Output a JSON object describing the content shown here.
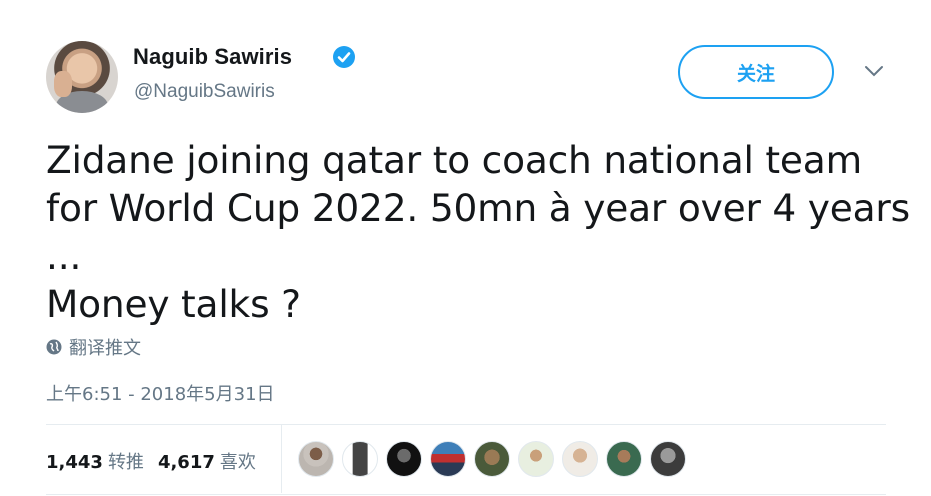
{
  "header": {
    "display_name": "Naguib Sawiris",
    "handle": "@NaguibSawiris",
    "verified": true,
    "follow_label": "关注",
    "accent_color": "#1da1f2"
  },
  "tweet": {
    "text": "Zidane joining qatar to coach national team\nfor World Cup 2022. 50mn à year over 4 years\n...\nMoney talks ?",
    "translate_label": "翻译推文",
    "timestamp": "上午6:51 - 2018年5月31日"
  },
  "stats": {
    "retweets_count": "1,443",
    "retweets_label": "转推",
    "likes_count": "4,617",
    "likes_label": "喜欢"
  },
  "likers": [
    {
      "name": "liker-1",
      "icon": "avatar"
    },
    {
      "name": "liker-2",
      "icon": "avatar"
    },
    {
      "name": "liker-3",
      "icon": "avatar"
    },
    {
      "name": "liker-4",
      "icon": "avatar"
    },
    {
      "name": "liker-5",
      "icon": "avatar"
    },
    {
      "name": "liker-6",
      "icon": "avatar"
    },
    {
      "name": "liker-7",
      "icon": "avatar"
    },
    {
      "name": "liker-8",
      "icon": "avatar"
    },
    {
      "name": "liker-9",
      "icon": "avatar"
    }
  ]
}
